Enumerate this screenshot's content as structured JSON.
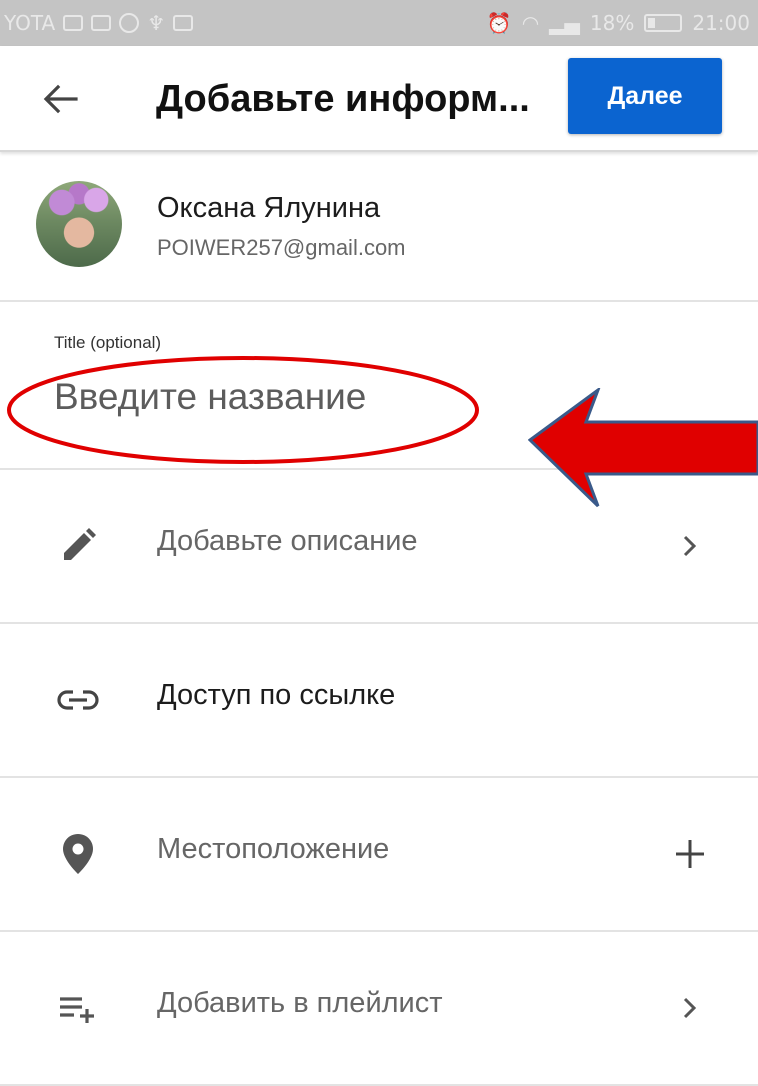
{
  "status_bar": {
    "carrier": "YOTA",
    "battery": "18%",
    "time": "21:00"
  },
  "app_bar": {
    "title": "Добавьте информ...",
    "next_label": "Далее"
  },
  "account": {
    "name": "Оксана Ялунина",
    "email": "POIWER257@gmail.com"
  },
  "title_field": {
    "label": "Title (optional)",
    "placeholder": "Введите название",
    "value": ""
  },
  "options": [
    {
      "label": "Добавьте описание",
      "icon": "pencil-icon",
      "trailing": "chevron-right-icon"
    },
    {
      "label": "Доступ по ссылке",
      "icon": "link-icon",
      "trailing": ""
    },
    {
      "label": "Местоположение",
      "icon": "location-pin-icon",
      "trailing": "plus-icon"
    },
    {
      "label": "Добавить в плейлист",
      "icon": "playlist-add-icon",
      "trailing": "chevron-right-icon"
    }
  ],
  "colors": {
    "primary_button": "#0b64d0",
    "annotation_red": "#e00000",
    "annotation_arrow_border": "#3a5a8a",
    "status_bar_bg": "#c4c4c4"
  }
}
